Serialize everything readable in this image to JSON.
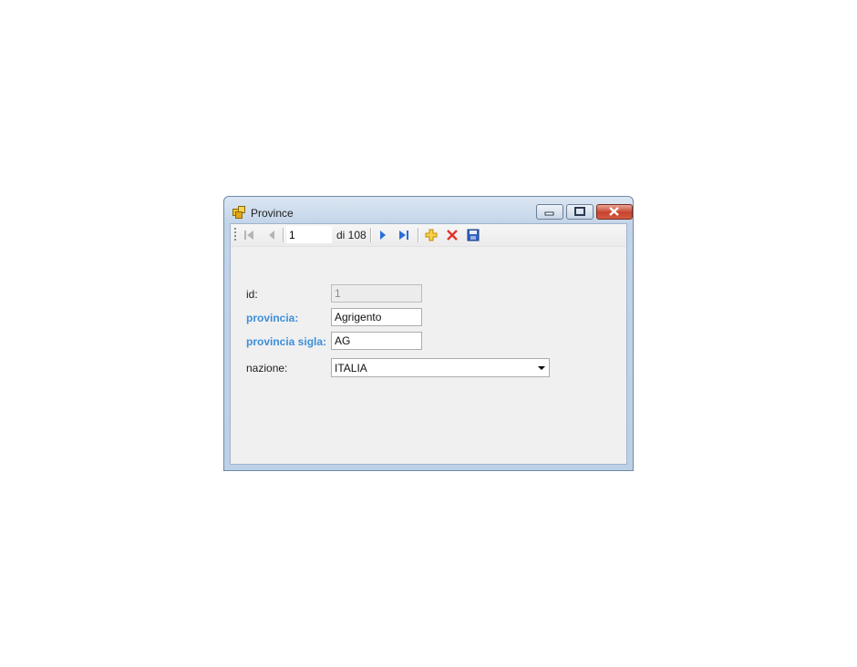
{
  "window": {
    "title": "Province"
  },
  "navigator": {
    "position": "1",
    "count_text": "di 108"
  },
  "form": {
    "id": {
      "label": "id:",
      "value": "1"
    },
    "provincia": {
      "label": "provincia:",
      "value": "Agrigento"
    },
    "sigla": {
      "label": "provincia sigla:",
      "value": "AG"
    },
    "nazione": {
      "label": "nazione:",
      "selected": "ITALIA"
    }
  },
  "colors": {
    "required_label": "#3d8fd9",
    "client_bg": "#f0f0f0"
  },
  "icons": [
    "move-first-icon",
    "move-previous-icon",
    "move-next-icon",
    "move-last-icon",
    "add-icon",
    "delete-icon",
    "save-icon"
  ]
}
